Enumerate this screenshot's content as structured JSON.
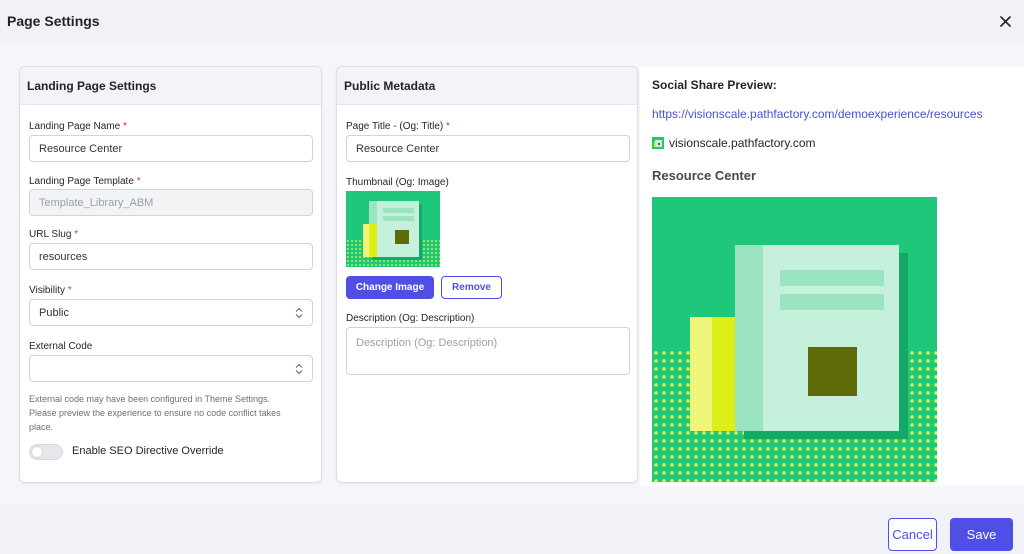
{
  "modal": {
    "title": "Page Settings"
  },
  "landing": {
    "header": "Landing Page Settings",
    "name_label": "Landing Page Name",
    "name_value": "Resource Center",
    "template_label": "Landing Page Template",
    "template_value": "Template_Library_ABM",
    "slug_label": "URL Slug",
    "slug_value": "resources",
    "visibility_label": "Visibility",
    "visibility_value": "Public",
    "external_code_label": "External Code",
    "external_code_value": "",
    "helper_line1": "External code may have been configured in Theme Settings.",
    "helper_line2": "Please preview the experience to ensure no code conflict takes",
    "helper_line3": "place.",
    "seo_toggle_label": "Enable SEO Directive Override"
  },
  "metadata": {
    "header": "Public Metadata",
    "title_label": "Page Title - (Og: Title)",
    "title_value": "Resource Center",
    "thumbnail_label": "Thumbnail (Og: Image)",
    "change_image_label": "Change Image",
    "remove_label": "Remove",
    "description_label": "Description (Og: Description)",
    "description_placeholder": "Description (Og: Description)"
  },
  "preview": {
    "heading": "Social Share Preview:",
    "url": "https://visionscale.pathfactory.com/demoexperience/resources",
    "domain": "visionscale.pathfactory.com",
    "title": "Resource Center"
  },
  "footer": {
    "cancel_label": "Cancel",
    "save_label": "Save"
  },
  "colors": {
    "accent": "#4f4fe6",
    "thumbnail_bg": "#1fc77b",
    "link": "#4a4fd6"
  }
}
